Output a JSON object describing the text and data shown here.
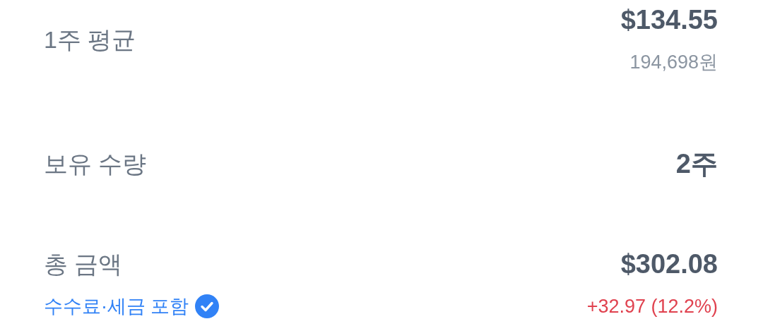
{
  "rows": [
    {
      "label": "1주 평균",
      "value": "$134.55",
      "sub": {
        "kind": "converted",
        "text": "194,698원"
      }
    },
    {
      "label": "보유 수량",
      "value": "2주"
    },
    {
      "label": "총 금액",
      "value": "$302.08",
      "note": {
        "text": "수수료·세금 포함",
        "checked": true
      },
      "sub": {
        "kind": "gain",
        "text": "+32.97 (12.2%)"
      }
    }
  ]
}
